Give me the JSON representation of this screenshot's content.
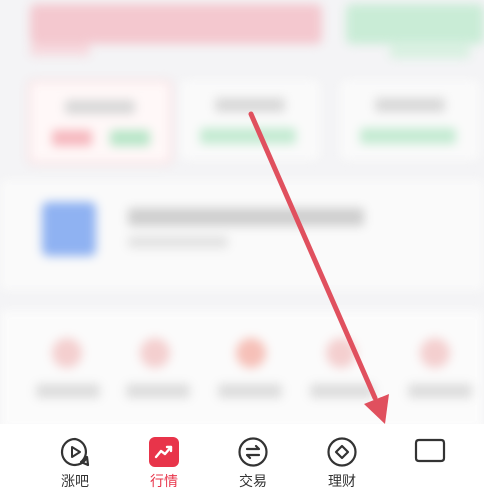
{
  "colors": {
    "accent": "#e8344a",
    "arrow": "#e0505e",
    "tab_inactive": "#333333",
    "tabbar_bg": "#ffffff"
  },
  "tabbar": {
    "tabs": [
      {
        "label": "涨吧",
        "icon": "play-chat-icon",
        "active": false
      },
      {
        "label": "行情",
        "icon": "chart-trend-icon",
        "active": true
      },
      {
        "label": "交易",
        "icon": "exchange-icon",
        "active": false
      },
      {
        "label": "理财",
        "icon": "diamond-icon",
        "active": false
      }
    ],
    "partial_tab_icon": "message-icon"
  }
}
